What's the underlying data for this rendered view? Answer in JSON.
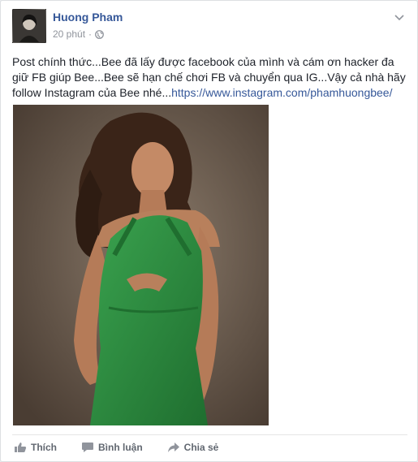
{
  "post": {
    "author": "Huong Pham",
    "time": "20 phút",
    "separator": "·",
    "text_before_link": "Post chính thức...Bee đã lấy được facebook của mình và cám ơn hacker đa giữ FB giúp Bee...Bee sẽ hạn chế chơi FB và chuyển qua IG...Vậy cả nhà hãy follow Instagram của Bee nhé...",
    "link": "https://www.instagram.com/phamhuongbee/",
    "photo_description": "woman in green halter dress",
    "icons": {
      "privacy": "globe-icon",
      "menu": "chevron-down-icon",
      "like": "thumbs-up-icon",
      "comment": "comment-icon",
      "share": "share-arrow-icon"
    }
  },
  "actions": {
    "like": "Thích",
    "comment": "Bình luận",
    "share": "Chia sẻ"
  },
  "colors": {
    "link": "#365899",
    "meta": "#90949c",
    "action": "#616770",
    "dress": "#2e8b3e"
  }
}
